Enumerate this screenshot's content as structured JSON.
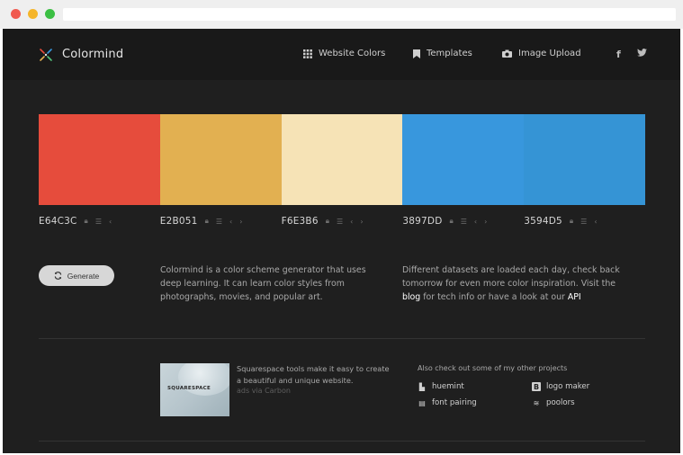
{
  "brand": {
    "name": "Colormind"
  },
  "nav": {
    "websites": "Website Colors",
    "templates": "Templates",
    "upload": "Image Upload"
  },
  "social": {
    "facebook": "f",
    "twitter": "🐦"
  },
  "palette": [
    {
      "hex": "E64C3C",
      "color": "#e64c3c"
    },
    {
      "hex": "E2B051",
      "color": "#e2b051"
    },
    {
      "hex": "F6E3B6",
      "color": "#f6e3b6"
    },
    {
      "hex": "3897DD",
      "color": "#3897dd"
    },
    {
      "hex": "3594D5",
      "color": "#3594d5"
    }
  ],
  "generate": {
    "label": "Generate"
  },
  "description": {
    "left": "Colormind is a color scheme generator that uses deep learning. It can learn color styles from photographs, movies, and popular art.",
    "right_before": "Different datasets are loaded each day, check back tomorrow for even more color inspiration. Visit the ",
    "blog_link": "blog",
    "right_middle": " for tech info or have a look at our ",
    "api_link": "API"
  },
  "ad": {
    "logo_text": "SQUARESPACE",
    "text": "Squarespace tools make it easy to create a beautiful and unique website.",
    "via": "ads via Carbon"
  },
  "projects": {
    "title": "Also check out some of my other projects",
    "items": [
      {
        "label": "huemint",
        "icon": "huemint-icon"
      },
      {
        "label": "logo maker",
        "icon": "logo-maker-icon"
      },
      {
        "label": "font pairing",
        "icon": "font-pairing-icon"
      },
      {
        "label": "poolors",
        "icon": "poolors-icon"
      }
    ]
  }
}
